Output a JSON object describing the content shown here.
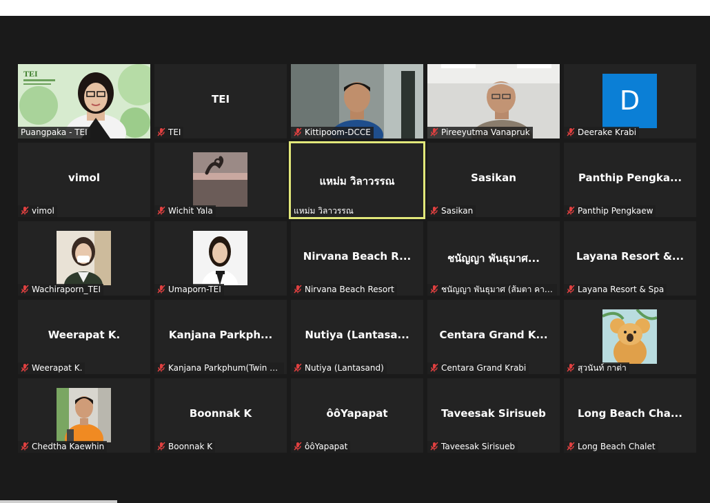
{
  "colors": {
    "background": "#1a1a1a",
    "tile": "#232323",
    "active_border": "#e2e87a",
    "muted_red": "#e04040",
    "avatar_blue": "#0b7fd6"
  },
  "participants": [
    {
      "name": "Puangpaka - TEI",
      "display": "",
      "video": true,
      "muted": false
    },
    {
      "name": "TEI",
      "display": "TEI",
      "video": false,
      "muted": true
    },
    {
      "name": "Kittipoom-DCCE",
      "display": "",
      "video": true,
      "muted": true
    },
    {
      "name": "Pireeyutma Vanapruk",
      "display": "",
      "video": true,
      "muted": true
    },
    {
      "name": "Deerake Krabi",
      "display": "",
      "avatar_letter": "D",
      "muted": true
    },
    {
      "name": "vimol",
      "display": "vimol",
      "muted": true
    },
    {
      "name": "Wichit Yala",
      "display": "",
      "muted": true
    },
    {
      "name": "แหม่ม วิลาวรรณ",
      "display": "แหม่ม วิลาวรรณ",
      "muted": false,
      "active": true
    },
    {
      "name": "Sasikan",
      "display": "Sasikan",
      "muted": true
    },
    {
      "name": "Panthip Pengkaew",
      "display": "Panthip  Pengka...",
      "muted": true
    },
    {
      "name": "Wachiraporn_TEI",
      "display": "",
      "muted": true
    },
    {
      "name": "Umaporn-TEI",
      "display": "",
      "muted": true
    },
    {
      "name": "Nirvana Beach Resort",
      "display": "Nirvana Beach R...",
      "muted": true
    },
    {
      "name": "ชนัญญา พันธุมาศ (ส้มตา คาซ...",
      "display": "ชนัญญา พันธุมาศ...",
      "muted": true
    },
    {
      "name": "Layana Resort & Spa",
      "display": "Layana Resort &...",
      "muted": true
    },
    {
      "name": "Weerapat K.",
      "display": "Weerapat K.",
      "muted": true
    },
    {
      "name": "Kanjana Parkphum(Twin Lo...",
      "display": "Kanjana  Parkph...",
      "muted": true
    },
    {
      "name": "Nutiya (Lantasand)",
      "display": "Nutiya  (Lantasa...",
      "muted": true
    },
    {
      "name": "Centara Grand Krabi",
      "display": "Centara Grand K...",
      "muted": true
    },
    {
      "name": "สุวนันท์ กาต่า",
      "display": "",
      "muted": true
    },
    {
      "name": "Chedtha Kaewhin",
      "display": "",
      "muted": true
    },
    {
      "name": "Boonnak K",
      "display": "Boonnak K",
      "muted": true
    },
    {
      "name": "ôôYapapat",
      "display": "ôôYapapat",
      "muted": true
    },
    {
      "name": "Taveesak Sirisueb",
      "display": "Taveesak Sirisueb",
      "muted": true
    },
    {
      "name": "Long Beach Chalet",
      "display": "Long  Beach  Cha...",
      "muted": true
    }
  ]
}
